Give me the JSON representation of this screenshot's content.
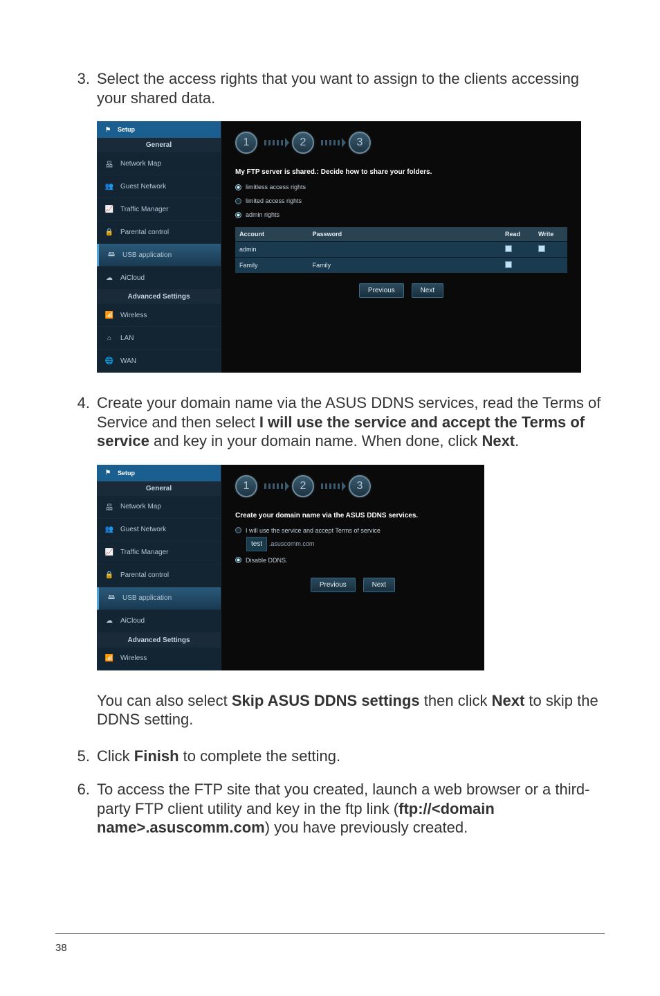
{
  "steps": {
    "s3": {
      "num": "3.",
      "text": "Select the access rights that you want to assign to the clients accessing your shared data."
    },
    "s4": {
      "num": "4.",
      "t1": "Create your domain name via the ASUS DDNS services, read the Terms of Service and then select ",
      "b1": "I will use the service and accept the Terms of service",
      "t2": " and key in your domain name. When done, click ",
      "b2": "Next",
      "t3": "."
    },
    "note": {
      "t1": "You can also select ",
      "b1": "Skip ASUS DDNS settings",
      "t2": " then click ",
      "b2": "Next",
      "t3": " to skip the DDNS setting."
    },
    "s5": {
      "num": "5.",
      "t1": "Click ",
      "b1": "Finish",
      "t2": " to complete the setting."
    },
    "s6": {
      "num": "6.",
      "t1": "To access the FTP site that you created, launch a web browser or a third-party FTP client utility and key in the ftp link (",
      "b1": "ftp://<domain name>.asuscomm.com",
      "t2": ") you have previously created."
    }
  },
  "router1": {
    "setup": "Setup",
    "general": "General",
    "nav": {
      "map": "Network Map",
      "guest": "Guest Network",
      "traffic": "Traffic Manager",
      "parental": "Parental control",
      "usb": "USB application",
      "aicloud": "AiCloud"
    },
    "advanced": "Advanced Settings",
    "adv": {
      "wireless": "Wireless",
      "lan": "LAN",
      "wan": "WAN"
    },
    "heading": "My FTP server is shared.: Decide how to share your folders.",
    "wiz": {
      "n1": "1",
      "n2": "2",
      "n3": "3"
    },
    "radios": {
      "r1": "limitless access rights",
      "r2": "limited access rights",
      "r3": "admin rights"
    },
    "thead": {
      "account": "Account",
      "password": "Password",
      "read": "Read",
      "write": "Write"
    },
    "rows": [
      {
        "account": "admin",
        "password": "",
        "read": true,
        "write": true
      },
      {
        "account": "Family",
        "password": "Family",
        "read": true,
        "write": false
      }
    ],
    "btns": {
      "prev": "Previous",
      "next": "Next"
    }
  },
  "router2": {
    "setup": "Setup",
    "general": "General",
    "nav": {
      "map": "Network Map",
      "guest": "Guest Network",
      "traffic": "Traffic Manager",
      "parental": "Parental control",
      "usb": "USB application",
      "aicloud": "AiCloud"
    },
    "advanced": "Advanced Settings",
    "adv": {
      "wireless": "Wireless"
    },
    "heading": "Create your domain name via the ASUS DDNS services.",
    "wiz": {
      "n1": "1",
      "n2": "2",
      "n3": "3"
    },
    "r1": "I will use the service and accept Terms of service",
    "input": "test",
    "suffix": ".asuscomm.com",
    "r2": "Disable DDNS.",
    "btns": {
      "prev": "Previous",
      "next": "Next"
    }
  },
  "pageNumber": "38"
}
